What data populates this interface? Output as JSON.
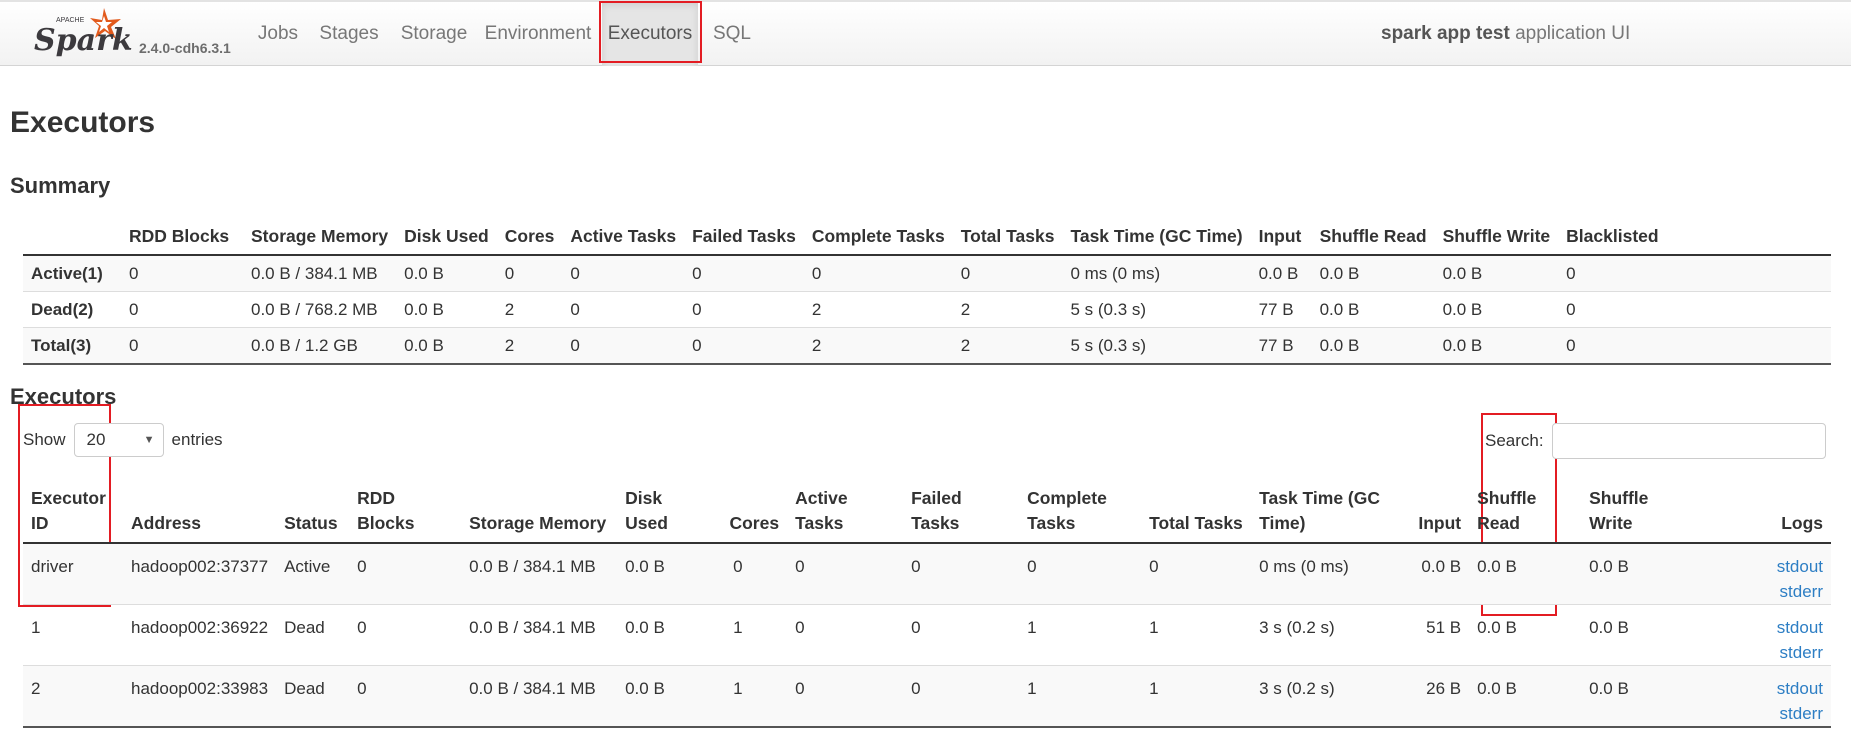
{
  "navbar": {
    "logo_text": "Spark",
    "logo_small": "APACHE",
    "version": "2.4.0-cdh6.3.1",
    "tabs": [
      {
        "label": "Jobs"
      },
      {
        "label": "Stages"
      },
      {
        "label": "Storage"
      },
      {
        "label": "Environment"
      },
      {
        "label": "Executors",
        "active": true
      },
      {
        "label": "SQL"
      }
    ],
    "app_name_bold": "spark app test",
    "app_name_rest": " application UI"
  },
  "page_title": "Executors",
  "summary": {
    "title": "Summary",
    "headers": [
      "",
      "RDD Blocks",
      "Storage Memory",
      "Disk Used",
      "Cores",
      "Active Tasks",
      "Failed Tasks",
      "Complete Tasks",
      "Total Tasks",
      "Task Time (GC Time)",
      "Input",
      "Shuffle Read",
      "Shuffle Write",
      "Blacklisted"
    ],
    "rows": [
      [
        "Active(1)",
        "0",
        "0.0 B / 384.1 MB",
        "0.0 B",
        "0",
        "0",
        "0",
        "0",
        "0",
        "0 ms (0 ms)",
        "0.0 B",
        "0.0 B",
        "0.0 B",
        "0"
      ],
      [
        "Dead(2)",
        "0",
        "0.0 B / 768.2 MB",
        "0.0 B",
        "2",
        "0",
        "0",
        "2",
        "2",
        "5 s (0.3 s)",
        "77 B",
        "0.0 B",
        "0.0 B",
        "0"
      ],
      [
        "Total(3)",
        "0",
        "0.0 B / 1.2 GB",
        "0.0 B",
        "2",
        "0",
        "0",
        "2",
        "2",
        "5 s (0.3 s)",
        "77 B",
        "0.0 B",
        "0.0 B",
        "0"
      ]
    ]
  },
  "executors": {
    "title": "Executors",
    "show_label": "Show",
    "entries_value": "20",
    "entries_label": "entries",
    "search_label": "Search:",
    "headers": [
      "Executor ID",
      "Address",
      "Status",
      "RDD Blocks",
      "Storage Memory",
      "Disk Used",
      "Cores",
      "Active Tasks",
      "Failed Tasks",
      "Complete Tasks",
      "Total Tasks",
      "Task Time (GC Time)",
      "Input",
      "Shuffle Read",
      "Shuffle Write",
      "Logs"
    ],
    "rows": [
      {
        "id": "driver",
        "address": "hadoop002:37377",
        "status": "Active",
        "rdd": "0",
        "storage": "0.0 B / 384.1 MB",
        "disk": "0.0 B",
        "cores": "0",
        "active": "0",
        "failed": "0",
        "complete": "0",
        "total": "0",
        "task_time": "0 ms (0 ms)",
        "input": "0.0 B",
        "shuffle_read": "0.0 B",
        "shuffle_write": "0.0 B",
        "log_stdout": "stdout",
        "log_stderr": "stderr"
      },
      {
        "id": "1",
        "address": "hadoop002:36922",
        "status": "Dead",
        "rdd": "0",
        "storage": "0.0 B / 384.1 MB",
        "disk": "0.0 B",
        "cores": "1",
        "active": "0",
        "failed": "0",
        "complete": "1",
        "total": "1",
        "task_time": "3 s (0.2 s)",
        "input": "51 B",
        "shuffle_read": "0.0 B",
        "shuffle_write": "0.0 B",
        "log_stdout": "stdout",
        "log_stderr": "stderr"
      },
      {
        "id": "2",
        "address": "hadoop002:33983",
        "status": "Dead",
        "rdd": "0",
        "storage": "0.0 B / 384.1 MB",
        "disk": "0.0 B",
        "cores": "1",
        "active": "0",
        "failed": "0",
        "complete": "1",
        "total": "1",
        "task_time": "3 s (0.2 s)",
        "input": "26 B",
        "shuffle_read": "0.0 B",
        "shuffle_write": "0.0 B",
        "log_stdout": "stdout",
        "log_stderr": "stderr"
      }
    ]
  },
  "colors": {
    "link": "#2d7ec4",
    "highlight_box": "#e31c23",
    "logo_orange": "#e25a1c"
  }
}
